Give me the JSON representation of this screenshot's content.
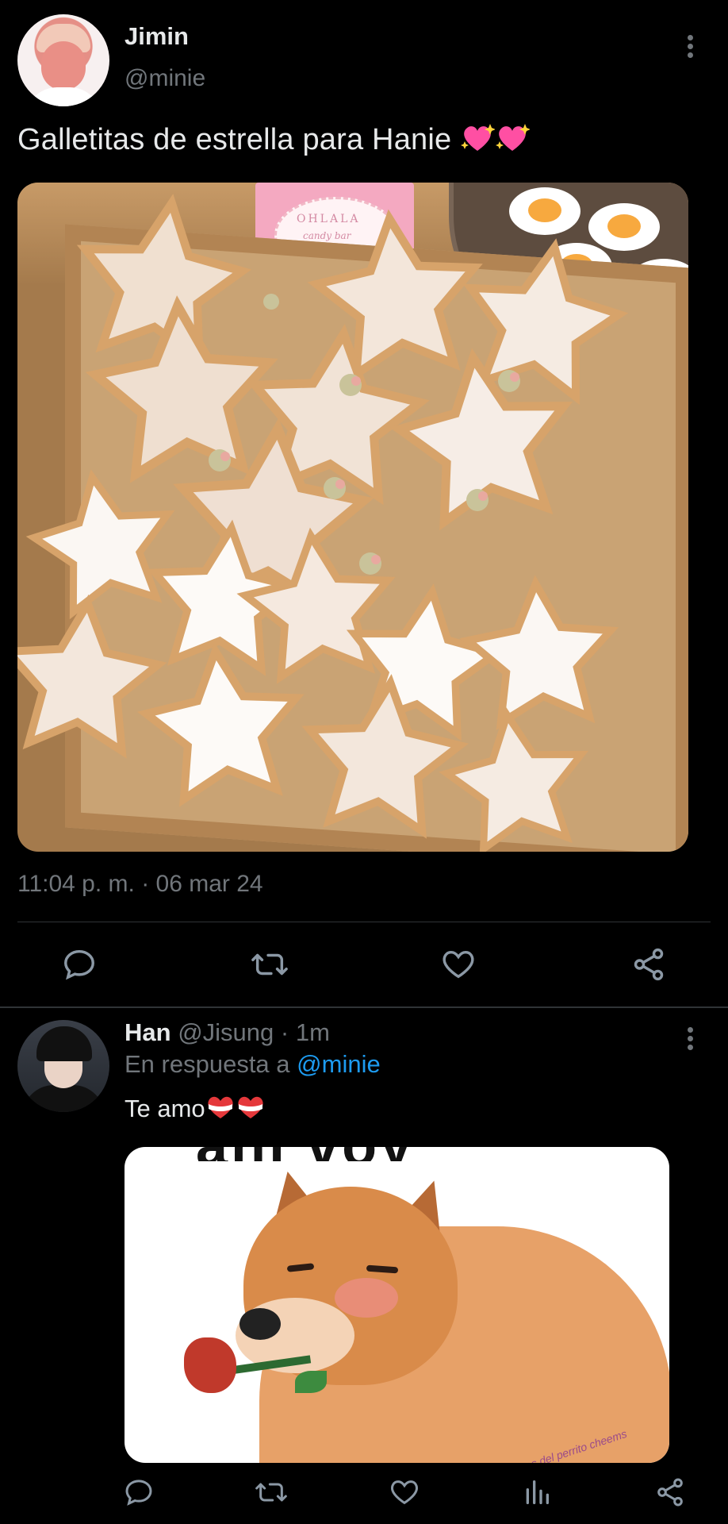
{
  "tweet": {
    "author_name": "Jimin",
    "author_handle": "@minie",
    "text": "Galletitas de estrella para Hanie",
    "timestamp": "11:04 p. m. · 06 mar 24",
    "media_tag_line1": "OHLALA",
    "media_tag_line2": "candy bar"
  },
  "reply": {
    "author_name": "Han",
    "meta": "@Jisung · 1m",
    "replying_prefix": "En respuesta a",
    "replying_to": "@minie",
    "text": "Te amo",
    "image_caption": "ahí voy",
    "image_watermark": "memes del perrito cheems"
  },
  "icons": {
    "reply": "reply-icon",
    "retweet": "retweet-icon",
    "like": "heart-icon",
    "views": "views-icon",
    "share": "share-icon",
    "more": "more-icon"
  },
  "colors": {
    "background": "#000000",
    "text_primary": "#e7e9ea",
    "text_secondary": "#71767b",
    "accent": "#1d9bf0",
    "divider": "#2f3336"
  }
}
